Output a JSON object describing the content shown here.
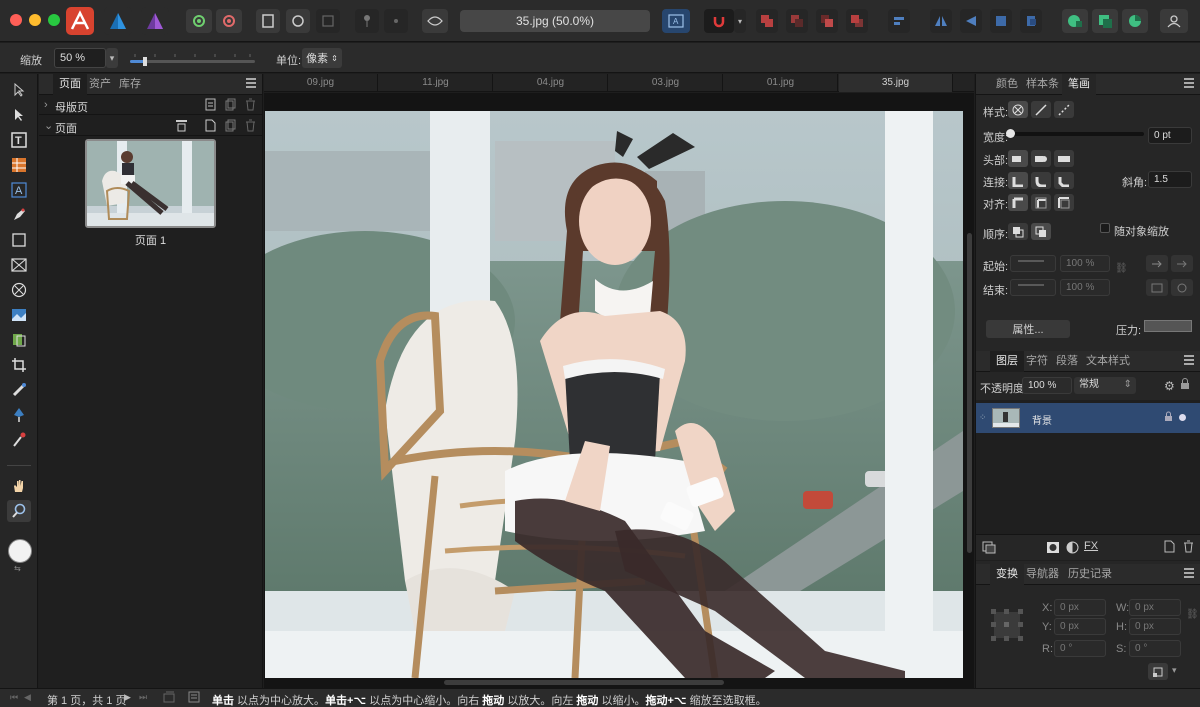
{
  "toolbar": {
    "document_title": "35.jpg (50.0%)",
    "apps": [
      "affinity-publisher",
      "affinity-designer",
      "affinity-photo"
    ]
  },
  "context_bar": {
    "zoom_label": "缩放",
    "zoom_value": "50 %",
    "zoom_slider_fraction": 0.12,
    "unit_label": "单位:",
    "unit_value": "像素"
  },
  "pages_panel": {
    "tabs": [
      "页面",
      "资产",
      "库存"
    ],
    "master_pages_label": "母版页",
    "pages_label": "页面",
    "page_thumb_label": "页面 1"
  },
  "document_tabs": [
    "09.jpg",
    "11.jpg",
    "04.jpg",
    "03.jpg",
    "01.jpg",
    "35.jpg"
  ],
  "active_document_tab": "35.jpg",
  "stroke_panel": {
    "tabs": [
      "颜色",
      "样本条",
      "笔画"
    ],
    "style_label": "样式:",
    "width_label": "宽度:",
    "width_value": "0 pt",
    "cap_label": "头部:",
    "join_label": "连接:",
    "miter_label": "斜角:",
    "miter_value": "1.5",
    "align_label": "对齐:",
    "order_label": "顺序:",
    "scale_with_object_label": "随对象缩放",
    "start_label": "起始:",
    "start_value": "100 %",
    "end_label": "结束:",
    "end_value": "100 %",
    "properties_button": "属性...",
    "pressure_label": "压力:"
  },
  "layers_panel": {
    "tabs": [
      "图层",
      "字符",
      "段落",
      "文本样式"
    ],
    "opacity_label": "不透明度:",
    "opacity_value": "100 %",
    "blend_mode": "常规",
    "layers": [
      {
        "name": "背景"
      }
    ]
  },
  "transform_panel": {
    "tabs": [
      "变换",
      "导航器",
      "历史记录"
    ],
    "x_label": "X:",
    "x_value": "0 px",
    "y_label": "Y:",
    "y_value": "0 px",
    "w_label": "W:",
    "w_value": "0 px",
    "h_label": "H:",
    "h_value": "0 px",
    "r_label": "R:",
    "r_value": "0 °",
    "s_label": "S:",
    "s_value": "0 °"
  },
  "status_bar": {
    "page_info": "第 1 页，共 1 页",
    "hint": [
      {
        "t": "单击",
        "b": true
      },
      {
        "t": " 以点为中心放大。",
        "b": false
      },
      {
        "t": "单击+⌥",
        "b": true
      },
      {
        "t": " 以点为中心缩小。向右 ",
        "b": false
      },
      {
        "t": "拖动",
        "b": true
      },
      {
        "t": " 以放大。向左 ",
        "b": false
      },
      {
        "t": "拖动",
        "b": true
      },
      {
        "t": " 以缩小。",
        "b": false
      },
      {
        "t": "拖动+⌥",
        "b": true
      },
      {
        "t": " 缩放至选取框。",
        "b": false
      }
    ]
  },
  "colors": {
    "accent_selection": "#2f4a72",
    "publisher_brand": "#d8432f",
    "designer_brand": "#1a6fb5",
    "photo_brand": "#6e3ba0"
  }
}
